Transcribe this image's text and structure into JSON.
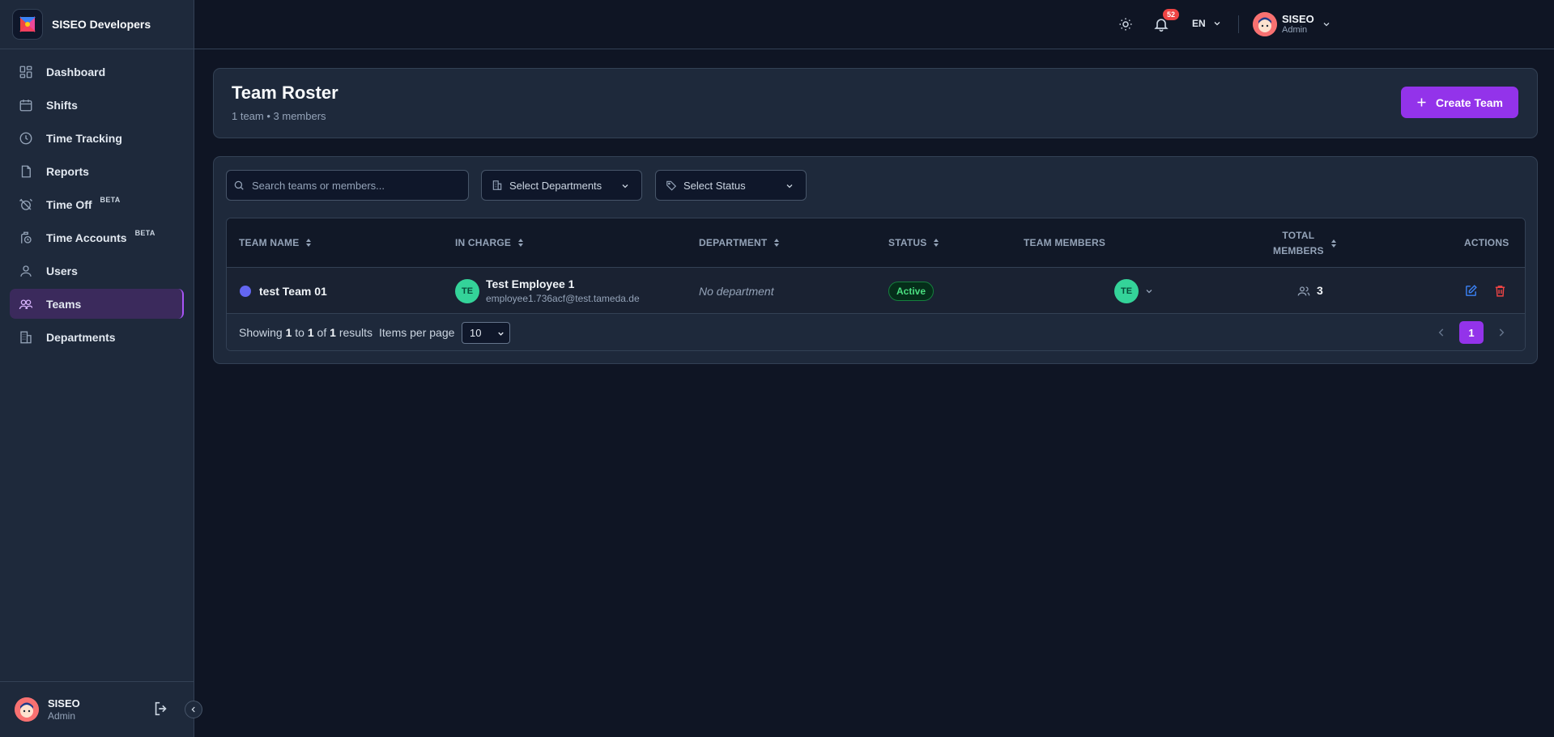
{
  "app": {
    "name": "SISEO Developers"
  },
  "sidebar": {
    "items": [
      {
        "label": "Dashboard",
        "icon": "dashboard-icon",
        "beta": ""
      },
      {
        "label": "Shifts",
        "icon": "calendar-icon",
        "beta": ""
      },
      {
        "label": "Time Tracking",
        "icon": "clock-icon",
        "beta": ""
      },
      {
        "label": "Reports",
        "icon": "report-icon",
        "beta": ""
      },
      {
        "label": "Time Off",
        "icon": "alarm-off-icon",
        "beta": "BETA"
      },
      {
        "label": "Time Accounts",
        "icon": "time-account-icon",
        "beta": "BETA"
      },
      {
        "label": "Users",
        "icon": "user-icon",
        "beta": ""
      },
      {
        "label": "Teams",
        "icon": "users-icon",
        "beta": "",
        "active": true
      },
      {
        "label": "Departments",
        "icon": "building-icon",
        "beta": ""
      }
    ],
    "footer": {
      "name": "SISEO",
      "role": "Admin"
    }
  },
  "topbar": {
    "notifications_count": "52",
    "language": "EN",
    "user": {
      "name": "SISEO",
      "role": "Admin"
    }
  },
  "header": {
    "title": "Team Roster",
    "subtitle": "1 team • 3 members",
    "create_label": "Create Team"
  },
  "filters": {
    "search_placeholder": "Search teams or members...",
    "departments_label": "Select Departments",
    "status_label": "Select Status"
  },
  "table": {
    "headers": {
      "team_name": "TEAM NAME",
      "in_charge": "IN CHARGE",
      "department": "DEPARTMENT",
      "status": "STATUS",
      "team_members": "TEAM MEMBERS",
      "total_line1": "TOTAL",
      "total_line2": "MEMBERS",
      "actions": "ACTIONS"
    },
    "rows": [
      {
        "team_name": "test Team 01",
        "team_color": "#6366f1",
        "in_charge_initials": "TE",
        "in_charge_name": "Test Employee 1",
        "in_charge_email": "employee1.736acf@test.tameda.de",
        "department": "No department",
        "status": "Active",
        "member_initials": "TE",
        "total_members": "3"
      }
    ]
  },
  "footer": {
    "showing_prefix": "Showing",
    "from": "1",
    "to_word": "to",
    "to": "1",
    "of_word": "of",
    "total": "1",
    "results_word": "results",
    "items_per_page_label": "Items per page",
    "items_per_page": "10",
    "current_page": "1"
  },
  "colors": {
    "accent": "#9333ea",
    "active": "#4ade80",
    "member_avatar": "#34d399"
  }
}
